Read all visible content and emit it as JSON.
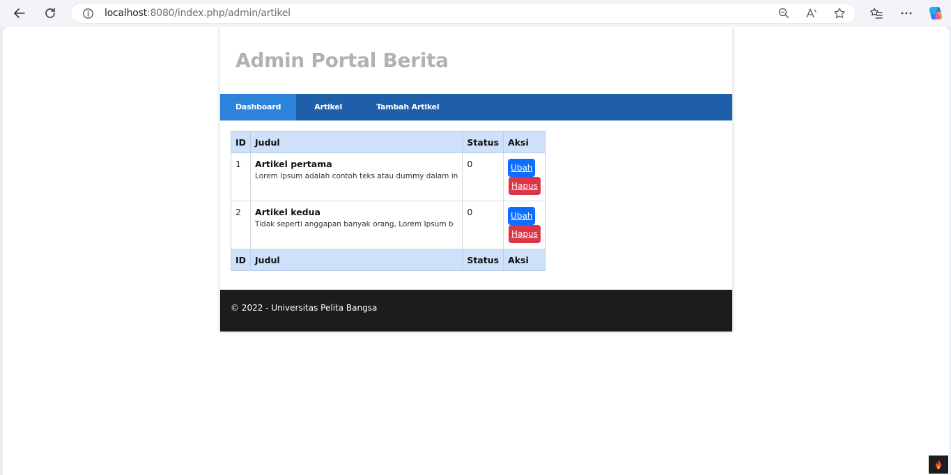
{
  "browser": {
    "url_host": "localhost",
    "url_rest": ":8080/index.php/admin/artikel"
  },
  "page": {
    "title": "Admin Portal Berita",
    "menu": [
      {
        "label": "Dashboard"
      },
      {
        "label": "Artikel"
      },
      {
        "label": "Tambah Artikel"
      }
    ],
    "table": {
      "headers": [
        "ID",
        "Judul",
        "Status",
        "Aksi"
      ],
      "rows": [
        {
          "id": "1",
          "title": "Artikel pertama",
          "desc": "Lorem Ipsum adalah contoh teks atau dummy dalam in",
          "status": "0",
          "edit": "Ubah",
          "delete": "Hapus"
        },
        {
          "id": "2",
          "title": "Artikel kedua",
          "desc": "Tidak seperti anggapan banyak orang, Lorem Ipsum b",
          "status": "0",
          "edit": "Ubah",
          "delete": "Hapus"
        }
      ],
      "footers": [
        "ID",
        "Judul",
        "Status",
        "Aksi"
      ]
    },
    "footer": "© 2022 - Universitas Pelita Bangsa"
  },
  "colors": {
    "nav_bar": "#1f5faa",
    "nav_active": "#2b83da",
    "table_head": "#cfe1fa",
    "btn_edit": "#0d6efd",
    "btn_delete": "#dc3545",
    "footer": "#1c1c1c"
  },
  "icons": [
    "back-icon",
    "reload-icon",
    "info-icon",
    "zoom-icon",
    "read-aloud-icon",
    "favorite-icon",
    "favorites-list-icon",
    "more-icon",
    "copilot-icon",
    "codeigniter-icon"
  ]
}
